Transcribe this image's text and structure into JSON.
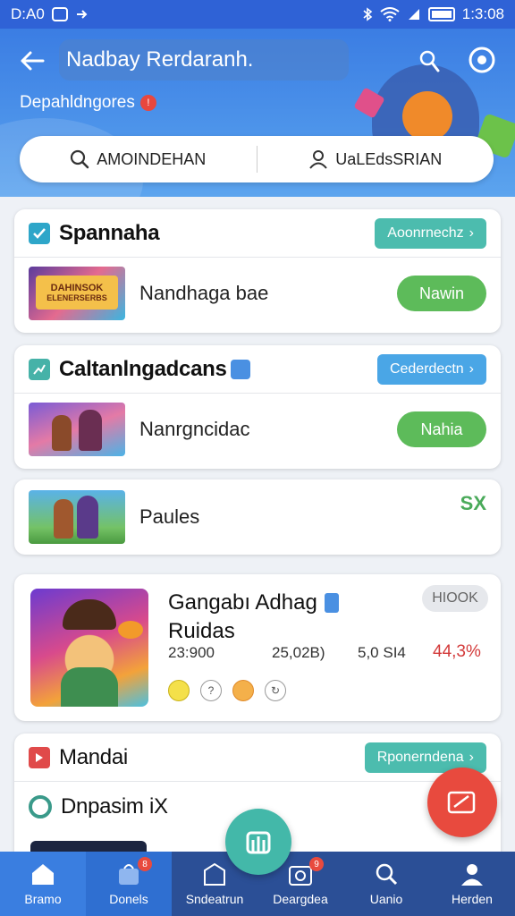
{
  "status_bar": {
    "left_text": "D:A0",
    "time": "1:3:08"
  },
  "header": {
    "title": "Nadbay Rerdaranh.",
    "subtitle": "Depahldngores",
    "search_left": "AMOINDEHAN",
    "search_right": "UaLEdsSRIAN"
  },
  "section1": {
    "title": "Spannaha",
    "action": "Aoonrnechz",
    "row_text": "Nandhaga bae",
    "row_button": "Nawin",
    "thumb_text_top": "DAHINSOK",
    "thumb_text_bottom": "ELENERSERBS"
  },
  "section2": {
    "title": "Caltanlngadcans",
    "action": "Cederdectn",
    "row1_text": "Nanrgncidac",
    "row1_button": "Nahia",
    "row2_text": "Paules",
    "row2_badge": "SX"
  },
  "feature": {
    "title_line1": "Gangabı Adhag",
    "title_line2": "Ruidas",
    "badge": "HIOOK",
    "stat1": "23:900",
    "stat2": "25,02B)",
    "stat3": "5,0 SI4",
    "stat4": "44,3%"
  },
  "section3": {
    "title": "Mandai",
    "action": "Rponerndena",
    "row_text": "Dnpasim iX"
  },
  "bottom_nav": [
    {
      "label": "Bramo",
      "icon": "home-icon"
    },
    {
      "label": "Donels",
      "icon": "bag-icon",
      "badge": "8"
    },
    {
      "label": "Sndeatrun",
      "icon": "building-icon"
    },
    {
      "label": "Deargdea",
      "icon": "camera-icon",
      "badge": "9"
    },
    {
      "label": "Uanio",
      "icon": "search-icon"
    },
    {
      "label": "Herden",
      "icon": "profile-icon"
    }
  ],
  "colors": {
    "primary": "#2f62d6",
    "teal": "#4cbcae",
    "green": "#5dbb5a",
    "red": "#e84a3e"
  }
}
